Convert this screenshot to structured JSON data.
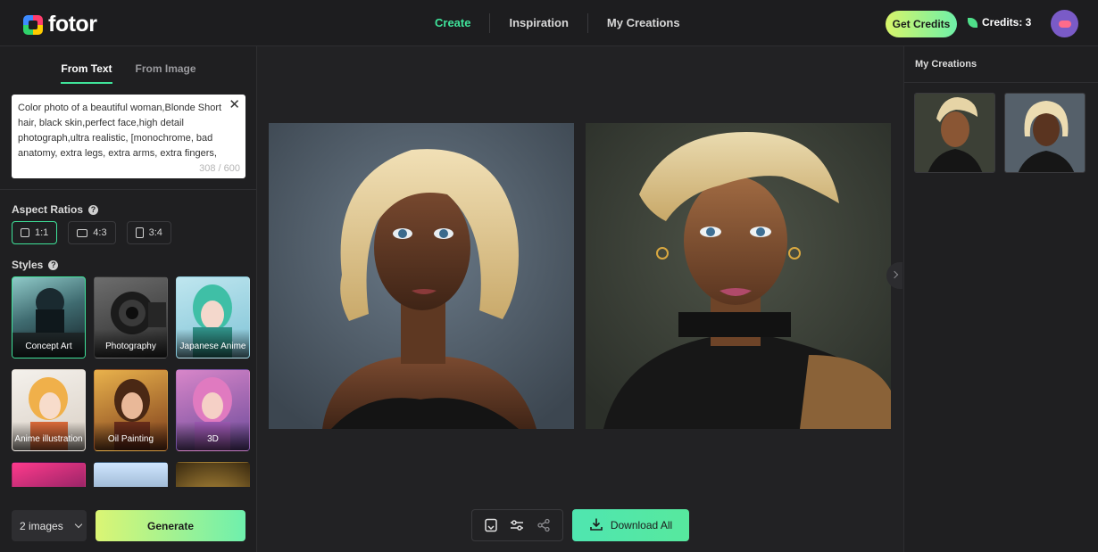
{
  "header": {
    "logo_text": "fotor",
    "nav": [
      "Create",
      "Inspiration",
      "My Creations"
    ],
    "get_credits": "Get Credits",
    "credits": "Credits: 3"
  },
  "left": {
    "tabs": [
      "From Text",
      "From Image"
    ],
    "prompt_text": "Color photo of a beautiful woman,Blonde Short hair, black skin,perfect face,high detail photograph,ultra realistic, [monochrome, bad anatomy, extra legs, extra arms, extra fingers,",
    "prompt_count": "308 / 600",
    "aspect_label": "Aspect Ratios",
    "ratios": [
      "1:1",
      "4:3",
      "3:4"
    ],
    "styles_label": "Styles",
    "styles": [
      "Concept Art",
      "Photography",
      "Japanese Anime",
      "Anime illustration",
      "Oil Painting",
      "3D"
    ],
    "image_count": "2 images",
    "generate": "Generate"
  },
  "center": {
    "download_all": "Download All"
  },
  "right": {
    "title": "My Creations"
  },
  "colors": {
    "accent": "#3fe39a",
    "background": "#222224",
    "panel": "#1f1f21"
  }
}
